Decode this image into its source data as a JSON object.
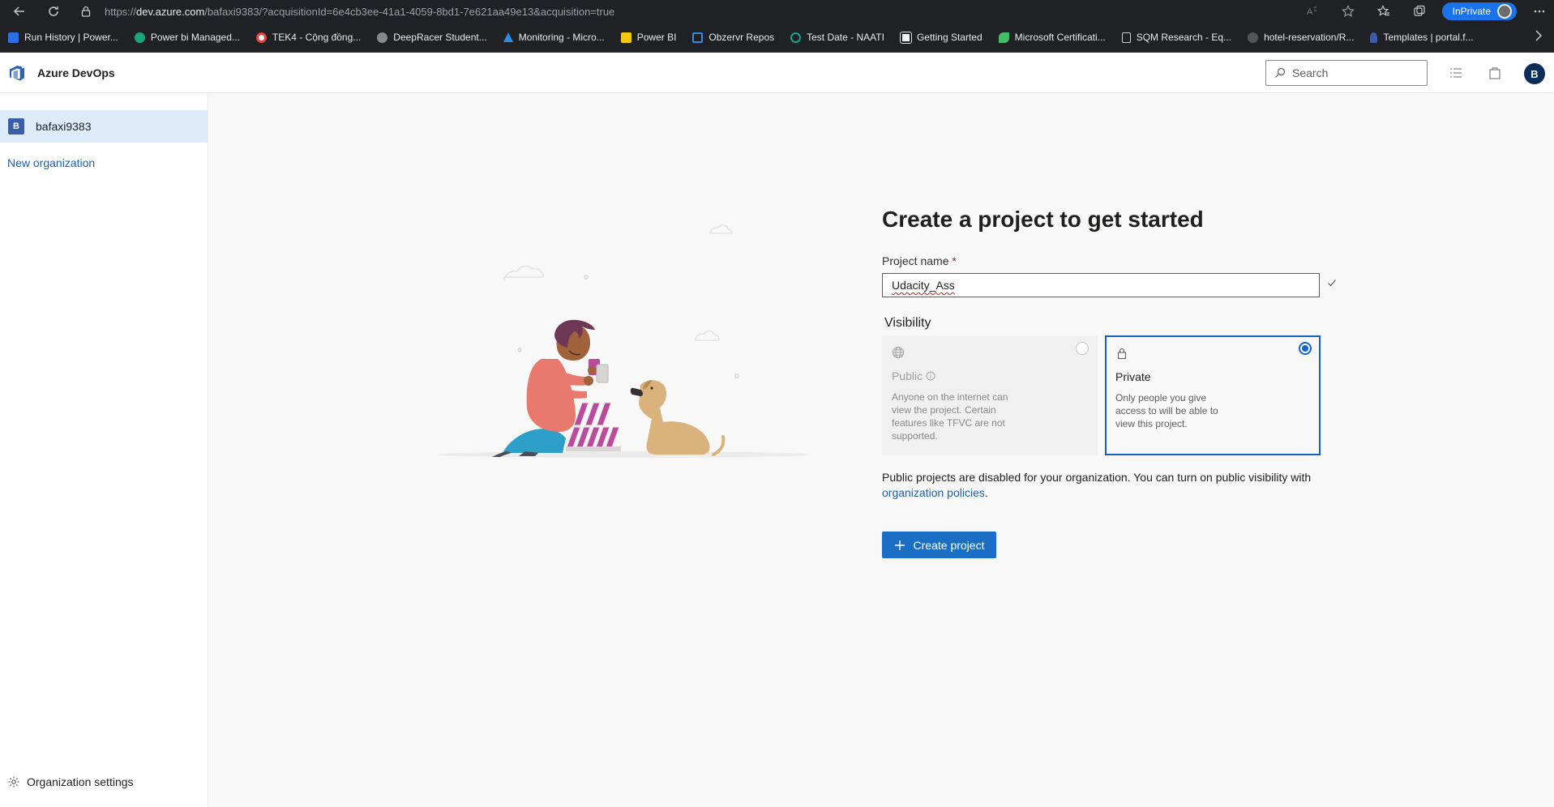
{
  "browser": {
    "url_prefix": "https://",
    "url_host": "dev.azure.com",
    "url_path": "/bafaxi9383/?acquisitionId=6e4cb3ee-41a1-4059-8bd1-7e621aa49e13&acquisition=true",
    "inprivate_label": "InPrivate",
    "bookmarks": [
      {
        "label": "Run History | Power...",
        "color": "#2f6fe4"
      },
      {
        "label": "Power bi Managed...",
        "color": "#1fa37a"
      },
      {
        "label": "TEK4 - Cộng đồng...",
        "color": "#e04444"
      },
      {
        "label": "DeepRacer Student...",
        "color": "#888888"
      },
      {
        "label": "Monitoring - Micro...",
        "color": "#2f8be4"
      },
      {
        "label": "Power BI",
        "color": "#f2c811"
      },
      {
        "label": "Obzervr Repos",
        "color": "#2f8be4"
      },
      {
        "label": "Test Date - NAATI",
        "color": "#17a589"
      },
      {
        "label": "Getting Started",
        "color": "#dddddd"
      },
      {
        "label": "Microsoft Certificati...",
        "color": "#44bb66"
      },
      {
        "label": "SQM Research - Eq...",
        "color": "#cccccc"
      },
      {
        "label": "hotel-reservation/R...",
        "color": "#555555"
      },
      {
        "label": "Templates | portal.f...",
        "color": "#3a5fa8"
      }
    ]
  },
  "header": {
    "brand": "Azure DevOps",
    "search_placeholder": "Search",
    "user_initial": "B"
  },
  "sidebar": {
    "org_initial": "B",
    "org_name": "bafaxi9383",
    "new_org_label": "New organization",
    "settings_label": "Organization settings"
  },
  "main": {
    "title": "Create a project to get started",
    "project_name_label": "Project name",
    "required_mark": "*",
    "project_name_value": "Udacity_Ass",
    "visibility_label": "Visibility",
    "public_title": "Public",
    "public_desc": "Anyone on the internet can view the project. Certain features like TFVC are not supported.",
    "private_title": "Private",
    "private_desc": "Only people you give access to will be able to view this project.",
    "selected_visibility": "Private",
    "notice_text": "Public projects are disabled for your organization. You can turn on public visibility with",
    "notice_link": "organization policies",
    "notice_end": ".",
    "create_button": "Create project"
  }
}
